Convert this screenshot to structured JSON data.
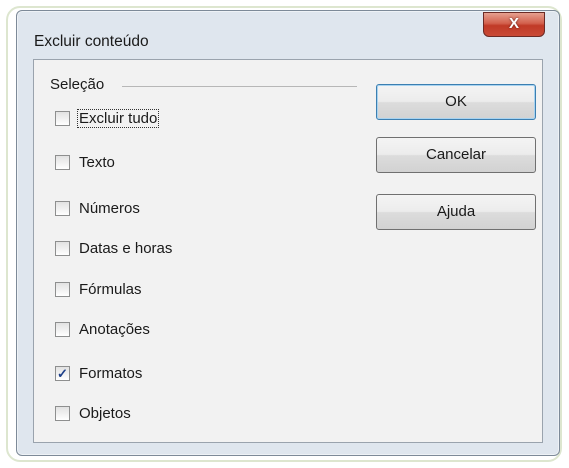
{
  "window": {
    "title": "Excluir conteúdo",
    "close_glyph": "X"
  },
  "selection_group": {
    "label": "Seleção",
    "options": [
      {
        "label": "Excluir tudo",
        "checked": false,
        "focused": true
      },
      {
        "label": "Texto",
        "checked": false
      },
      {
        "label": "Números",
        "checked": false
      },
      {
        "label": "Datas e horas",
        "checked": false
      },
      {
        "label": "Fórmulas",
        "checked": false
      },
      {
        "label": "Anotações",
        "checked": false
      },
      {
        "label": "Formatos",
        "checked": true
      },
      {
        "label": "Objetos",
        "checked": false
      }
    ]
  },
  "buttons": {
    "ok": "OK",
    "cancel": "Cancelar",
    "help": "Ajuda"
  },
  "colors": {
    "close_button": "#c94a36",
    "default_button_border": "#3c7fb1",
    "check_mark": "#1d3f8a"
  }
}
